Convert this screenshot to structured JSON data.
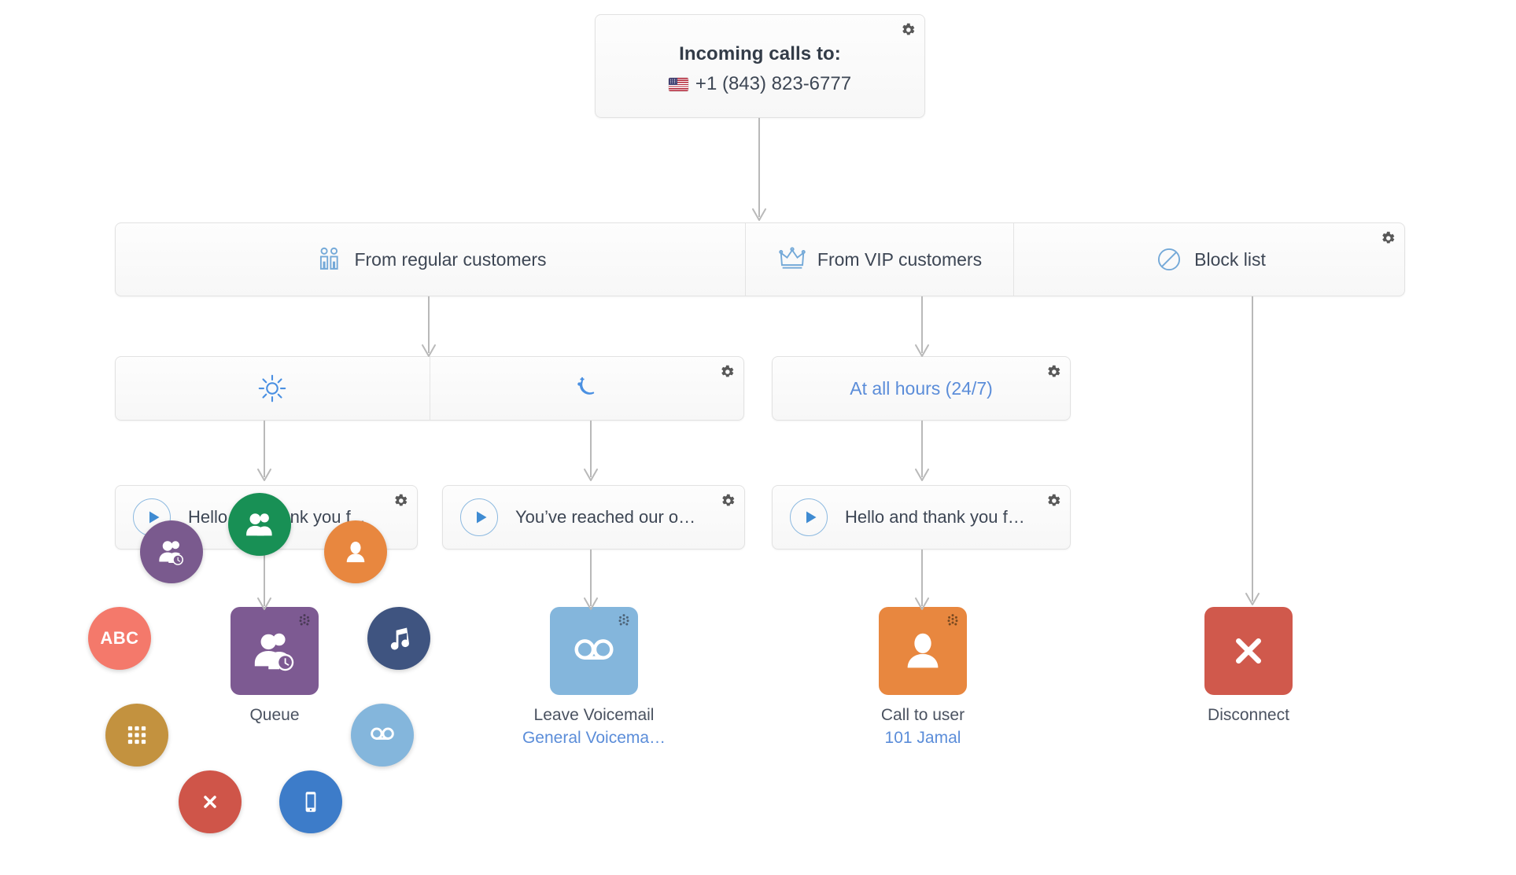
{
  "root": {
    "title": "Incoming calls to:",
    "phone_number": "+1 (843) 823-6777",
    "flag": "us-flag-icon",
    "gear": "gear-icon"
  },
  "routing_segments": [
    {
      "label": "From regular customers",
      "icon": "two-people-icon"
    },
    {
      "label": "From VIP customers",
      "icon": "crown-icon"
    },
    {
      "label": "Block list",
      "icon": "circle-slash-icon"
    }
  ],
  "schedules": {
    "regular": [
      {
        "icon": "sun-icon",
        "label": "Daytime"
      },
      {
        "icon": "moon-icon",
        "label": "Nighttime"
      }
    ],
    "vip": {
      "label": "At all hours (24/7)"
    }
  },
  "greetings": [
    {
      "text": "Hell…hank y… f…",
      "full_text": "Hello and thank you f...",
      "play": "play-icon"
    },
    {
      "text": "You’ve reached our o…",
      "play": "play-icon"
    },
    {
      "text": "Hello and thank you f…",
      "play": "play-icon"
    }
  ],
  "actions": [
    {
      "label": "Queue",
      "sub": "",
      "icon": "people-clock-icon",
      "color": "#7d5a92",
      "drag": true
    },
    {
      "label": "Leave Voicemail",
      "sub": "General Voicema…",
      "icon": "voicemail-icon",
      "color": "#84b6dc",
      "drag": true
    },
    {
      "label": "Call to user",
      "sub": "101 Jamal",
      "icon": "user-icon",
      "color": "#e8873f",
      "drag": true
    },
    {
      "label": "Disconnect",
      "sub": "",
      "icon": "close-x-icon",
      "color": "#d0594c",
      "drag": false
    }
  ],
  "radial_menu": [
    {
      "name": "queue",
      "icon": "people-clock-icon",
      "color": "#7a5a8e",
      "label": "Queue"
    },
    {
      "name": "ring-group",
      "icon": "two-people-icon",
      "color": "#189055",
      "label": "Ring group"
    },
    {
      "name": "user",
      "icon": "user-icon",
      "color": "#e8873f",
      "label": "User"
    },
    {
      "name": "abc",
      "icon": "abc-icon",
      "color": "#f4796b",
      "label": "ABC"
    },
    {
      "name": "music",
      "icon": "music-note-icon",
      "color": "#3f5480",
      "label": "Music on hold"
    },
    {
      "name": "keypad",
      "icon": "keypad-icon",
      "color": "#c3923f",
      "label": "Keypad menu"
    },
    {
      "name": "voicemail",
      "icon": "voicemail-icon",
      "color": "#84b6dc",
      "label": "Voicemail"
    },
    {
      "name": "hangup",
      "icon": "close-x-icon",
      "color": "#cf5549",
      "label": "Disconnect"
    },
    {
      "name": "mobile",
      "icon": "mobile-phone-icon",
      "color": "#3d7cc9",
      "label": "Mobile"
    }
  ],
  "colors": {
    "line": "#b9b9b9",
    "accent_blue": "#5b8dd9",
    "icon_blue": "#74a9d8",
    "text": "#3d4654"
  }
}
